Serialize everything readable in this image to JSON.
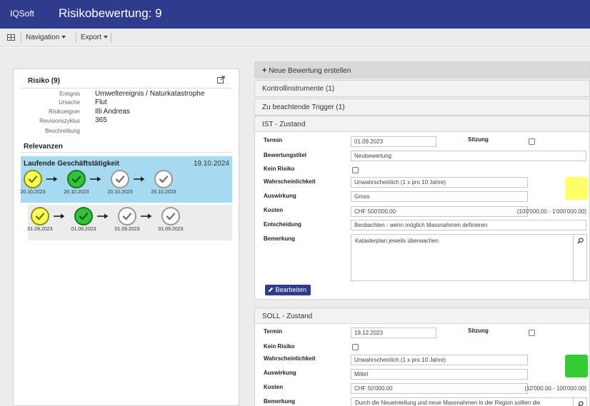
{
  "header": {
    "brand": "IQSoft",
    "title": "Risikobewertung: 9"
  },
  "menu": {
    "navigation": "Navigation",
    "export": "Export"
  },
  "risk_panel": {
    "title": "Risiko (9)",
    "fields": [
      {
        "label": "Ereignis",
        "value": "Umweltereignis / Naturkatastrophe"
      },
      {
        "label": "Ursache",
        "value": "Flut"
      },
      {
        "label": "Risikoeigner",
        "value": "Illi Andreas"
      },
      {
        "label": "Revisionszyklus",
        "value": "365"
      },
      {
        "label": "Beschreibung",
        "value": ""
      }
    ],
    "relevanzen_title": "Relevanzen",
    "flow_active": {
      "name": "Laufende Geschäftstätigkeit",
      "date": "19.10.2024",
      "steps": [
        {
          "state": "yellow",
          "date": "20.10.2023"
        },
        {
          "state": "green",
          "date": "20.10.2023"
        },
        {
          "state": "white",
          "date": "20.10.2023"
        },
        {
          "state": "white",
          "date": "20.10.2023"
        }
      ]
    },
    "flow_grey": {
      "steps": [
        {
          "state": "yellow",
          "date": "01.09.2023"
        },
        {
          "state": "green",
          "date": "01.09.2023"
        },
        {
          "state": "white",
          "date": "01.09.2023"
        },
        {
          "state": "white",
          "date": "01.09.2023"
        }
      ]
    }
  },
  "actions": {
    "new_assessment": "Neue Bewertung erstellen",
    "kontrollinstrumente": "Kontrollinstrumente  (1)",
    "trigger": "Zu beachtende Trigger  (1)"
  },
  "ist": {
    "title": "IST - Zustand",
    "termin_label": "Termin",
    "termin": "01.09.2023",
    "sitzung_label": "Sitzung",
    "titel_label": "Bewertungstitel",
    "titel": "Neubewertung",
    "kein_risiko_label": "Kein Risiko",
    "wahrscheinlichkeit_label": "Wahrscheinlichkeit",
    "wahrscheinlichkeit": "Unwahrscheinlich (1 x pro 10 Jahre)",
    "auswirkung_label": "Auswirkung",
    "auswirkung": "Gross",
    "kosten_label": "Kosten",
    "kosten": "CHF 500'000.00",
    "kosten_range": "(100'000.00 - 1'000'000.00)",
    "entscheidung_label": "Entscheidung",
    "entscheidung": "Beobachten - wenn möglich Massnahmen definieren",
    "bemerkung_label": "Bemerkung",
    "bemerkung": "Katasterplan jeweils überwachen",
    "edit_button": "Bearbeiten",
    "color": "#ffff66"
  },
  "soll": {
    "title": "SOLL - Zustand",
    "termin_label": "Termin",
    "termin": "19.12.2023",
    "sitzung_label": "Sitzung",
    "kein_risiko_label": "Kein Risiko",
    "wahrscheinlichkeit_label": "Wahrscheinlichkeit",
    "wahrscheinlichkeit": "Unwahrscheinlich (1 x pro 10 Jahre)",
    "auswirkung_label": "Auswirkung",
    "auswirkung": "Mittel",
    "kosten_label": "Kosten",
    "kosten": "CHF 50'000.00",
    "kosten_range": "(10'000.00 - 100'000.00)",
    "bemerkung_label": "Bemerkung",
    "bemerkung": "Durch die Neueinteilung und neue Massnahmen in der Region sollten die",
    "color": "#33cc33"
  }
}
